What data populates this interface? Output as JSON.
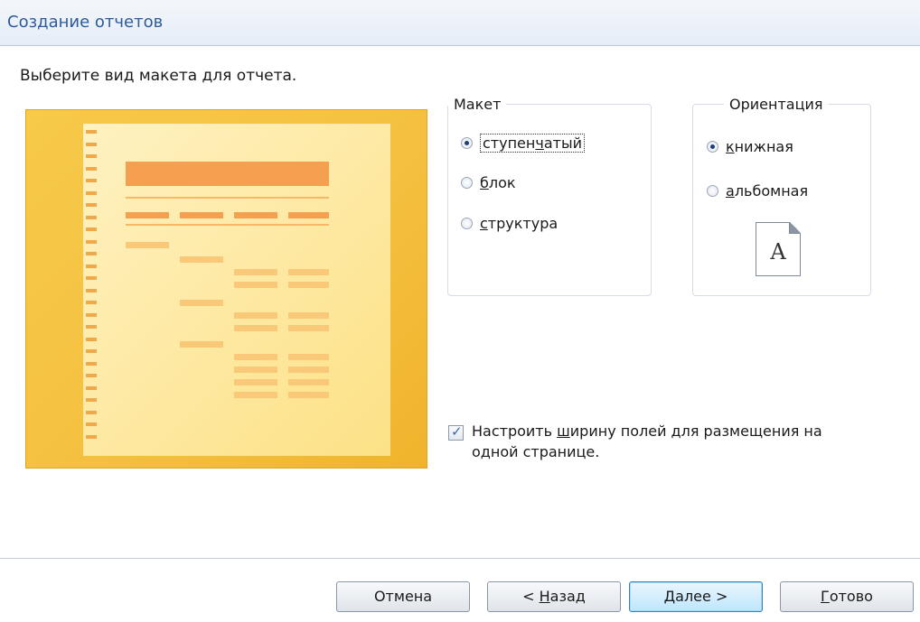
{
  "window": {
    "title": "Создание отчетов"
  },
  "prompt": "Выберите вид макета для отчета.",
  "layout_group": {
    "legend": "Макет",
    "options": [
      {
        "pre": "ступен",
        "ul": "ч",
        "post": "атый",
        "selected": true
      },
      {
        "pre": "",
        "ul": "б",
        "post": "лок",
        "selected": false
      },
      {
        "pre": "",
        "ul": "с",
        "post": "труктура",
        "selected": false
      }
    ]
  },
  "orientation_group": {
    "legend": "Ориентация",
    "options": [
      {
        "pre": "",
        "ul": "к",
        "post": "нижная",
        "selected": true
      },
      {
        "pre": "",
        "ul": "а",
        "post": "льбомная",
        "selected": false
      }
    ],
    "icon_letter": "A"
  },
  "fit_checkbox": {
    "checked": true,
    "line1_pre": "Настроить ",
    "line1_ul": "ш",
    "line1_post": "ирину полей для размещения на",
    "line2": "одной странице."
  },
  "buttons": {
    "cancel": "Отмена",
    "back_pre": "< ",
    "back_ul": "Н",
    "back_post": "азад",
    "next_ul": "Д",
    "next_post": "алее >",
    "finish_ul": "Г",
    "finish_post": "отово"
  },
  "colors": {
    "title_text": "#2f5a9a",
    "preview_bg": "#f5c040",
    "preview_bar": "#f4a050",
    "default_button": "#bee6fd"
  }
}
